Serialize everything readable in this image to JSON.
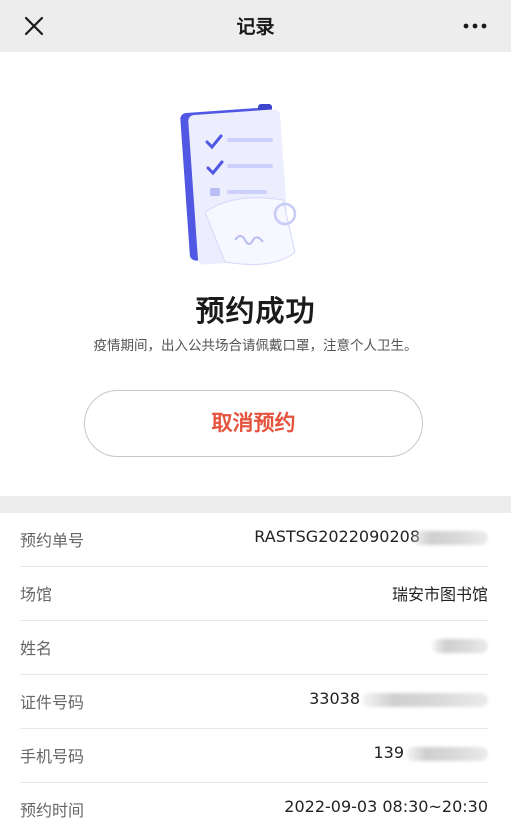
{
  "nav": {
    "title": "记录",
    "close_icon": "close-icon",
    "more_icon": "more-icon"
  },
  "hero": {
    "illustration_icon": "document-check-icon",
    "title": "预约成功",
    "subtitle": "疫情期间，出入公共场合请佩戴口罩，注意个人卫生。",
    "cancel_label": "取消预约"
  },
  "details": {
    "rows": [
      {
        "label": "预约单号",
        "value": "RASTSG2022090208"
      },
      {
        "label": "场馆",
        "value": "瑞安市图书馆"
      },
      {
        "label": "姓名",
        "value": ""
      },
      {
        "label": "证件号码",
        "value": "33038"
      },
      {
        "label": "手机号码",
        "value": "139"
      },
      {
        "label": "预约时间",
        "value": "2022-09-03 08:30~20:30"
      }
    ]
  },
  "colors": {
    "accent": "#e5533d",
    "background": "#ededed",
    "illustration": "#5b63e8"
  }
}
